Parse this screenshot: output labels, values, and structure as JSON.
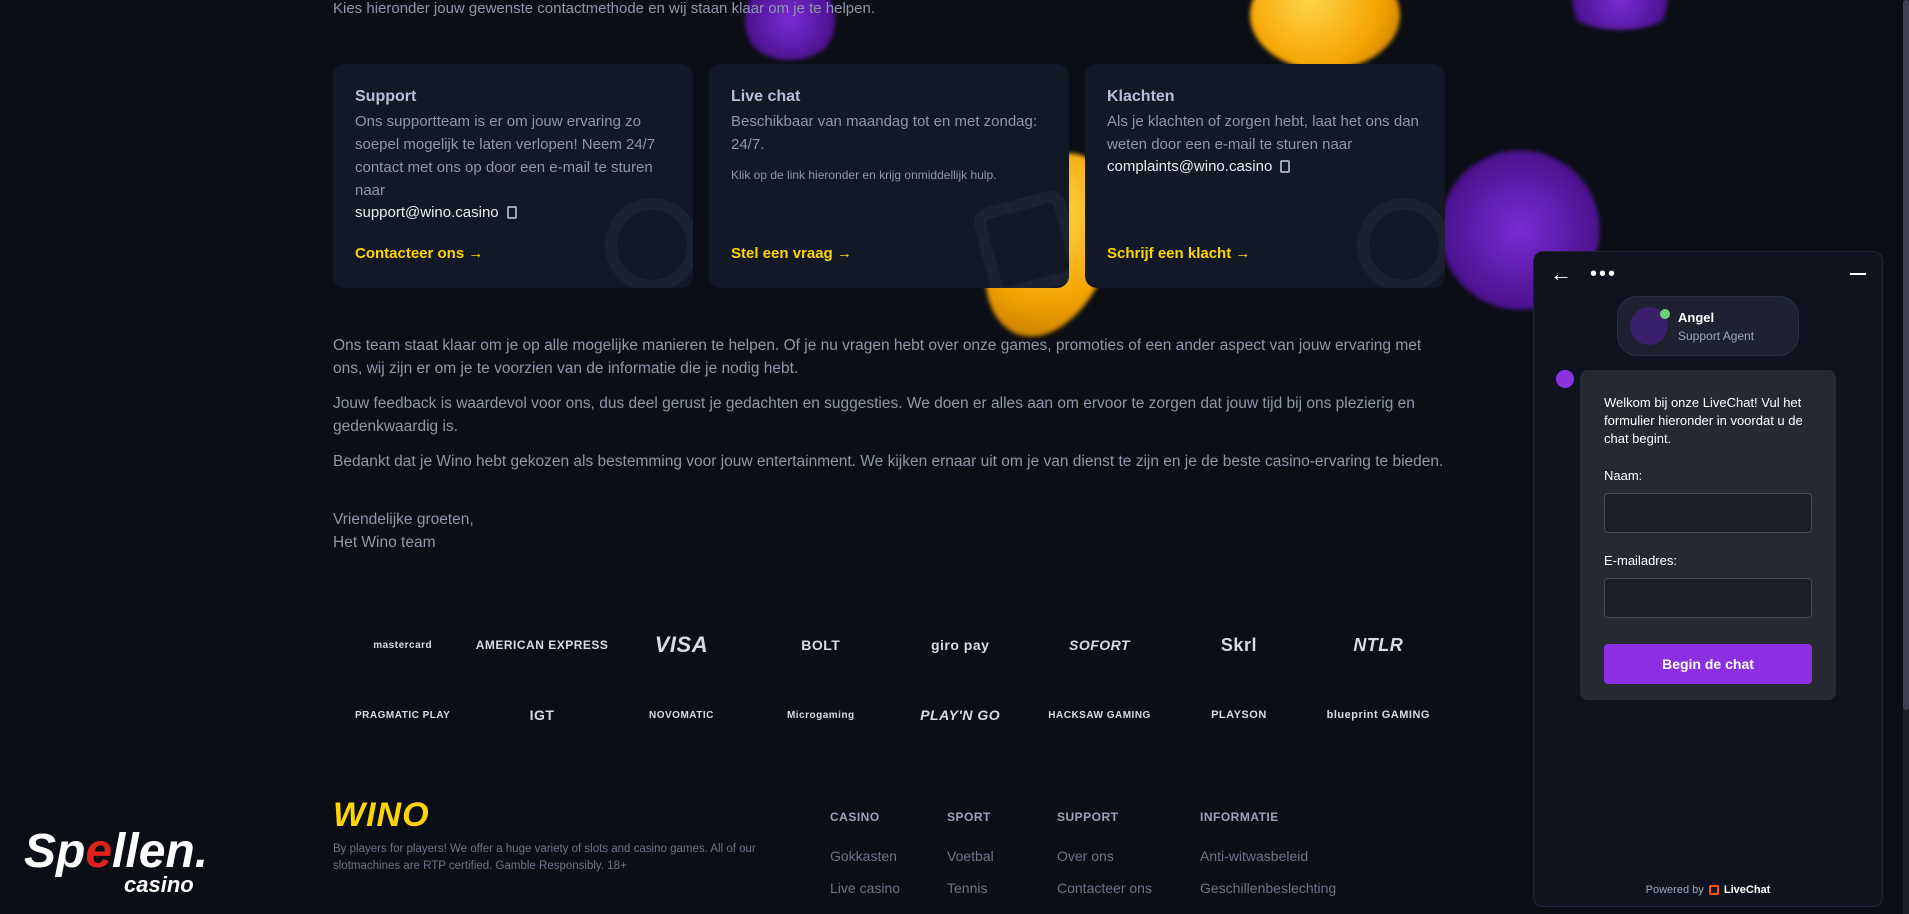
{
  "intro": "Kies hieronder jouw gewenste contactmethode en wij staan klaar om je te helpen.",
  "cards": [
    {
      "title": "Support",
      "text": "Ons supportteam is er om jouw ervaring zo soepel mogelijk te laten verlopen! Neem 24/7 contact met ons op door een e-mail te sturen naar",
      "email": "support@wino.casino",
      "cta": "Contacteer ons →"
    },
    {
      "title": "Live chat",
      "text": "Beschikbaar van maandag tot en met zondag: 24/7.",
      "small": "Klik op de link hieronder en krijg onmiddellijk hulp.",
      "cta": "Stel een vraag →"
    },
    {
      "title": "Klachten",
      "text": "Als je klachten of zorgen hebt, laat het ons dan weten door een e-mail te sturen naar",
      "email": "complaints@wino.casino",
      "cta": "Schrijf een klacht →"
    }
  ],
  "paragraphs": [
    "Ons team staat klaar om je op alle mogelijke manieren te helpen. Of je nu vragen hebt over onze games, promoties of een ander aspect van jouw ervaring met ons, wij zijn er om je te voorzien van de informatie die je nodig hebt.",
    "Jouw feedback is waardevol voor ons, dus deel gerust je gedachten en suggesties. We doen er alles aan om ervoor te zorgen dat jouw tijd bij ons plezierig en gedenkwaardig is.",
    "Bedankt dat je Wino hebt gekozen als bestemming voor jouw entertainment. We kijken ernaar uit om je van dienst te zijn en je de beste casino-ervaring te bieden.",
    "Vriendelijke groeten,",
    "Het Wino team"
  ],
  "payment_logos": [
    "mastercard",
    "AMERICAN EXPRESS",
    "VISA",
    "BOLT",
    "giro pay",
    "SOFORT",
    "Skrl",
    "NTLR"
  ],
  "provider_logos": [
    "PRAGMATIC PLAY",
    "IGT",
    "NOVOMATIC",
    "Microgaming",
    "PLAY'N GO",
    "HACKSAW GAMING",
    "PLAYSON",
    "blueprint GAMING"
  ],
  "footer": {
    "brand": "WINO",
    "text": "By players for players! We offer a huge variety of slots and casino games. All of our slotmachines are RTP certified. Gamble Responsibly. 18+",
    "columns": [
      {
        "title": "CASINO",
        "links": [
          "Gokkasten",
          "Live casino"
        ]
      },
      {
        "title": "SPORT",
        "links": [
          "Voetbal",
          "Tennis"
        ]
      },
      {
        "title": "SUPPORT",
        "links": [
          "Over ons",
          "Contacteer ons"
        ]
      },
      {
        "title": "INFORMATIE",
        "links": [
          "Anti-witwasbeleid",
          "Geschillenbeslechting"
        ]
      }
    ]
  },
  "watermark": {
    "line1_pre": "Sp",
    "line1_accent": "e",
    "line1_post": "llen.",
    "line2": "casino"
  },
  "chat": {
    "agent_name": "Angel",
    "agent_role": "Support Agent",
    "welcome": "Welkom bij onze LiveChat! Vul het formulier hieronder in voordat u de chat begint.",
    "name_label": "Naam:",
    "email_label": "E-mailadres:",
    "start_button": "Begin de chat",
    "powered_by": "Powered by",
    "brand": "LiveChat"
  },
  "colors": {
    "accent": "#ffd500",
    "chat_button": "#8b2fe3",
    "background": "#0b0e14"
  }
}
